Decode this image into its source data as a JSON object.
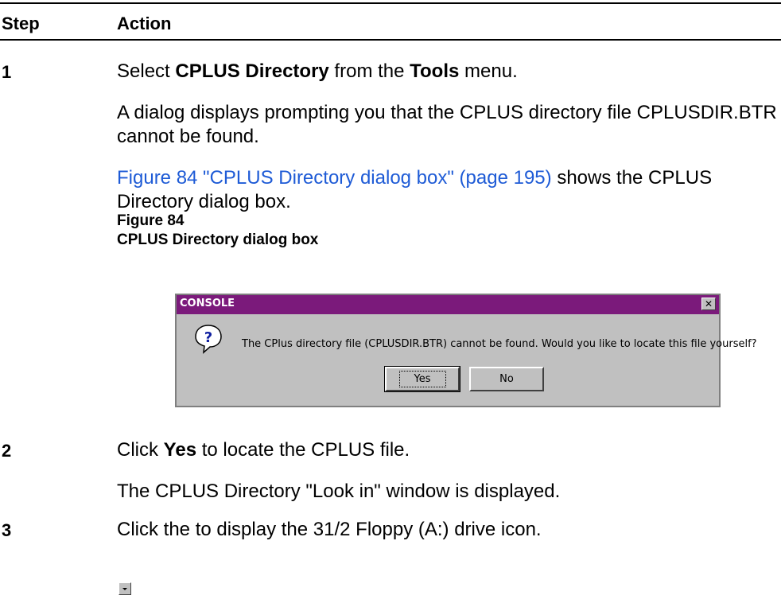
{
  "header": {
    "step": "Step",
    "action": "Action"
  },
  "steps": [
    {
      "number": "1",
      "line1": {
        "pre": "Select ",
        "b1": "CPLUS Directory",
        "mid": " from the ",
        "b2": "Tools",
        "post": " menu."
      },
      "para2": "A dialog displays prompting you that the CPLUS directory file CPLUSDIR.BTR cannot be found.",
      "para3_link": "Figure 84 \"CPLUS Directory dialog box\" (page 195)",
      "para3_rest": " shows the CPLUS Directory dialog box.",
      "figure_label": "Figure 84",
      "figure_title": "CPLUS Directory dialog box"
    },
    {
      "number": "2",
      "line1": {
        "pre": "Click ",
        "b1": "Yes",
        "post": " to locate the CPLUS file."
      },
      "para2": "The CPLUS Directory \"Look in\" window is displayed."
    },
    {
      "number": "3",
      "line1": "Click the to display the 31/2 Floppy (A:) drive icon."
    }
  ],
  "dialog": {
    "title": "CONSOLE",
    "close_glyph": "✕",
    "message": "The CPlus directory file (CPLUSDIR.BTR) cannot be found. Would you like to locate this file yourself?",
    "yes_label": "Yes",
    "no_label": "No",
    "icon": "question-icon",
    "titlebar_color": "#7b1a7b"
  },
  "colors": {
    "link": "#1e5bd6"
  }
}
